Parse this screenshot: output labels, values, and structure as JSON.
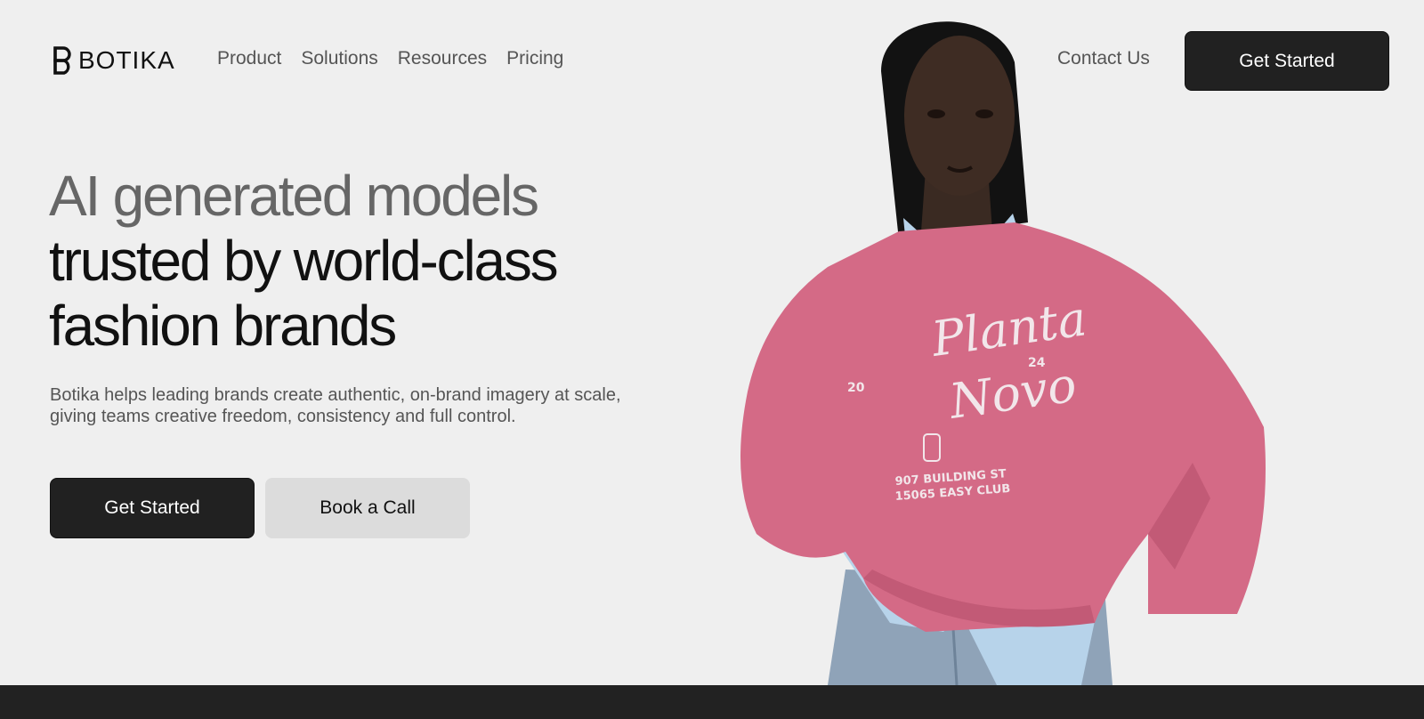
{
  "brand": {
    "name": "BOTIKA"
  },
  "nav": {
    "items": [
      {
        "label": "Product"
      },
      {
        "label": "Solutions"
      },
      {
        "label": "Resources"
      },
      {
        "label": "Pricing"
      }
    ],
    "contact_label": "Contact Us",
    "cta_label": "Get Started"
  },
  "hero": {
    "headline_muted": "AI generated models",
    "headline_line2": "trusted by world-class",
    "headline_line3": "fashion brands",
    "subtext": "Botika helps leading brands create authentic, on-brand imagery at scale, giving teams creative freedom, consistency and full control.",
    "primary_cta": "Get Started",
    "secondary_cta": "Book a Call"
  },
  "model_image": {
    "sweatshirt_script_line1": "Planta",
    "sweatshirt_script_line2": "Novo",
    "sweatshirt_year_left": "20",
    "sweatshirt_year_right": "24",
    "sweatshirt_block_line1": "907 BUILDING ST",
    "sweatshirt_block_line2": "15065 EASY CLUB"
  },
  "colors": {
    "background": "#efefef",
    "button_dark": "#212121",
    "button_light": "#dcdcdc",
    "sweatshirt_pink": "#d46a86",
    "shirt_blue": "#b7d3ea",
    "footer_bar": "#222222"
  }
}
